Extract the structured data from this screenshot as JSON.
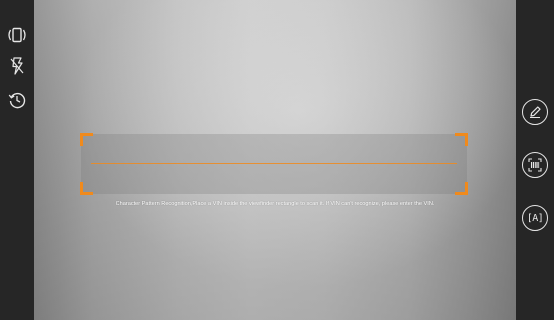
{
  "hint_text": "Character Pattern Recognition,Place a VIN inside the viewfinder rectangle to scan it. If VIN can't recognize, please enter the VIN.",
  "left_toolbar": {
    "icons": [
      "rotate-screen-icon",
      "flash-off-icon",
      "history-icon"
    ]
  },
  "right_toolbar": {
    "buttons": [
      "edit-icon",
      "barcode-scan-icon",
      "text-recognition-icon"
    ],
    "ocr_label": "[A]"
  },
  "colors": {
    "accent": "#f08a1c",
    "sidebar": "#262626",
    "icon": "#e6e6e6"
  }
}
